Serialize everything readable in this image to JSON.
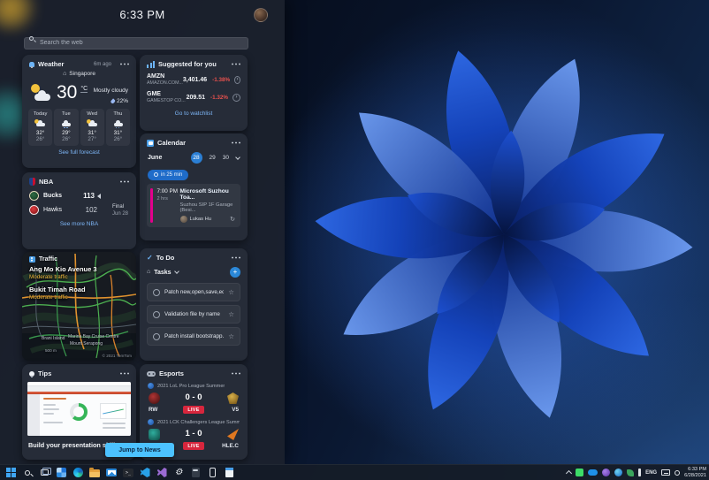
{
  "panel": {
    "time": "6:33 PM",
    "search_placeholder": "Search the web",
    "jump_button": "Jump to News",
    "weather": {
      "title": "Weather",
      "updated": "6m ago",
      "location": "Singapore",
      "temp": "30",
      "unit": "°C",
      "condition": "Mostly cloudy",
      "precip": "22%",
      "days": [
        {
          "name": "Today",
          "hi": "32°",
          "lo": "26°",
          "icon": "partly-cloudy-icon"
        },
        {
          "name": "Tue",
          "hi": "29°",
          "lo": "26°",
          "icon": "rain-icon"
        },
        {
          "name": "Wed",
          "hi": "31°",
          "lo": "27°",
          "icon": "partly-cloudy-icon"
        },
        {
          "name": "Thu",
          "hi": "31°",
          "lo": "26°",
          "icon": "rain-icon"
        }
      ],
      "link": "See full forecast"
    },
    "stocks": {
      "title": "Suggested for you",
      "rows": [
        {
          "symbol": "AMZN",
          "company": "AMAZON.COM...",
          "price": "3,401.46",
          "change": "-1.38%"
        },
        {
          "symbol": "GME",
          "company": "GAMESTOP CO...",
          "price": "209.51",
          "change": "-1.32%"
        }
      ],
      "link": "Go to watchlist"
    },
    "calendar": {
      "title": "Calendar",
      "month": "June",
      "dates": [
        "28",
        "29",
        "30"
      ],
      "pill": "in 25 min",
      "event": {
        "time": "7:00 PM",
        "duration": "2 hrs",
        "title": "Microsoft Suzhou Toa...",
        "location": "Suzhou SIP 1F Garage (Besi...",
        "attendee": "Lukas Hu"
      }
    },
    "nba": {
      "title": "NBA",
      "teams": [
        {
          "name": "Bucks",
          "score": "113"
        },
        {
          "name": "Hawks",
          "score": "102"
        }
      ],
      "status": "Final",
      "date": "Jun 28",
      "link": "See more NBA"
    },
    "traffic": {
      "title": "Traffic",
      "roads": [
        {
          "name": "Ang Mo Kio Avenue 3",
          "status": "Moderate traffic"
        },
        {
          "name": "Bukit Timah Road",
          "status": "Moderate traffic"
        }
      ],
      "labels": {
        "island": "Brani Island",
        "centre": "Marina Bay Cruise Centre",
        "mount": "Mount Serapong"
      },
      "scale": "500 m",
      "attribution": "© 2021 TomTom"
    },
    "todo": {
      "title": "To Do",
      "list": "Tasks",
      "tasks": [
        {
          "label": "Patch new,open,save,edi..."
        },
        {
          "label": "Validation file by name"
        },
        {
          "label": "Patch install bootstrapp..."
        }
      ]
    },
    "tips": {
      "title": "Tips",
      "caption": "Build your presentation skills"
    },
    "esports": {
      "title": "Esports",
      "matches": [
        {
          "league": "2021 LoL Pro League Summer",
          "left": "RW",
          "right": "V5",
          "score": "0 - 0",
          "badge": "LIVE"
        },
        {
          "league": "2021 LCK Challengers League Summer",
          "left": "",
          "right": "HLE.C",
          "score": "1 - 0",
          "badge": "LIVE"
        }
      ]
    }
  },
  "taskbar": {
    "lang": "ENG",
    "clock_time": "6:33 PM",
    "clock_date": "6/28/2021",
    "icons": [
      "start",
      "search",
      "task-view",
      "photos",
      "edge",
      "file-explorer",
      "mail",
      "terminal",
      "vs-code",
      "visual-studio",
      "settings",
      "calculator",
      "phone-link",
      "notepad"
    ]
  },
  "colors": {
    "accent": "#4cc2ff",
    "link": "#7db5f5",
    "negative": "#e8514e",
    "live_badge": "#d7263d",
    "event_bar": "#e3008c",
    "moderate_traffic": "#f0b840"
  }
}
